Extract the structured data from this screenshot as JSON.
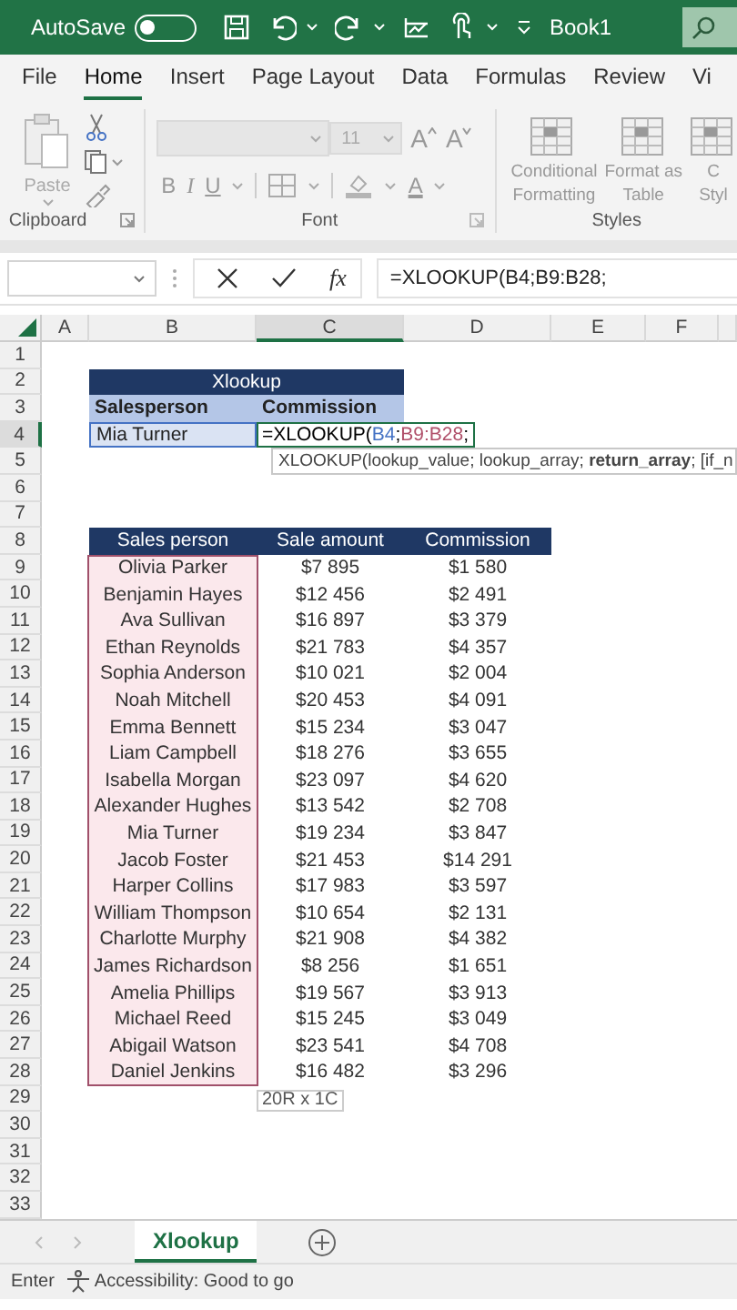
{
  "title_bar": {
    "autosave_label": "AutoSave",
    "autosave_on": false,
    "title": "Book1"
  },
  "tabs": [
    {
      "label": "File",
      "selected": false
    },
    {
      "label": "Home",
      "selected": true
    },
    {
      "label": "Insert",
      "selected": false
    },
    {
      "label": "Page Layout",
      "selected": false
    },
    {
      "label": "Data",
      "selected": false
    },
    {
      "label": "Formulas",
      "selected": false
    },
    {
      "label": "Review",
      "selected": false
    },
    {
      "label": "Vi",
      "selected": false
    }
  ],
  "ribbon": {
    "clipboard": {
      "paste": "Paste",
      "label": "Clipboard"
    },
    "font": {
      "size": "11",
      "grow": "A",
      "shrink": "A",
      "bold": "B",
      "italic": "I",
      "underline": "U",
      "font_color": "A",
      "label": "Font"
    },
    "styles": {
      "buttons": [
        {
          "line1": "Conditional",
          "line2": "Formatting"
        },
        {
          "line1": "Format as",
          "line2": "Table"
        },
        {
          "line1": "C",
          "line2": "Styl"
        }
      ],
      "label": "Styles"
    }
  },
  "formula_bar": {
    "fx": "fx",
    "formula": "=XLOOKUP(B4;B9:B28;"
  },
  "columns": [
    {
      "label": "A",
      "selected": false
    },
    {
      "label": "B",
      "selected": false
    },
    {
      "label": "C",
      "selected": true
    },
    {
      "label": "D",
      "selected": false
    },
    {
      "label": "E",
      "selected": false
    },
    {
      "label": "F",
      "selected": false
    }
  ],
  "rows": [
    {
      "label": "1",
      "selected": false
    },
    {
      "label": "2",
      "selected": false
    },
    {
      "label": "3",
      "selected": false
    },
    {
      "label": "4",
      "selected": true
    },
    {
      "label": "5",
      "selected": false
    },
    {
      "label": "6",
      "selected": false
    },
    {
      "label": "7",
      "selected": false
    },
    {
      "label": "8",
      "selected": false
    },
    {
      "label": "9",
      "selected": false
    },
    {
      "label": "10",
      "selected": false
    },
    {
      "label": "11",
      "selected": false
    },
    {
      "label": "12",
      "selected": false
    },
    {
      "label": "13",
      "selected": false
    },
    {
      "label": "14",
      "selected": false
    },
    {
      "label": "15",
      "selected": false
    },
    {
      "label": "16",
      "selected": false
    },
    {
      "label": "17",
      "selected": false
    },
    {
      "label": "18",
      "selected": false
    },
    {
      "label": "19",
      "selected": false
    },
    {
      "label": "20",
      "selected": false
    },
    {
      "label": "21",
      "selected": false
    },
    {
      "label": "22",
      "selected": false
    },
    {
      "label": "23",
      "selected": false
    },
    {
      "label": "24",
      "selected": false
    },
    {
      "label": "25",
      "selected": false
    },
    {
      "label": "26",
      "selected": false
    },
    {
      "label": "27",
      "selected": false
    },
    {
      "label": "28",
      "selected": false
    },
    {
      "label": "29",
      "selected": false
    },
    {
      "label": "30",
      "selected": false
    },
    {
      "label": "31",
      "selected": false
    },
    {
      "label": "32",
      "selected": false
    },
    {
      "label": "33",
      "selected": false
    }
  ],
  "lookup_table": {
    "title": "Xlookup",
    "headers": [
      "Salesperson",
      "Commission"
    ],
    "value": "Mia Turner",
    "formula_parts": [
      {
        "text": "=XLOOKUP(",
        "color": "#000000"
      },
      {
        "text": "B4",
        "color": "#4472c4"
      },
      {
        "text": ";",
        "color": "#000000"
      },
      {
        "text": "B9:B28",
        "color": "#b0506a"
      },
      {
        "text": ";",
        "color": "#000000"
      }
    ]
  },
  "tooltip": "XLOOKUP(lookup_value; lookup_array; **return_array**; [if_n",
  "sales_table": {
    "headers": [
      "Sales person",
      "Sale amount",
      "Commission"
    ],
    "name_range_highlighted": true,
    "rows": [
      {
        "name": "Olivia Parker",
        "sale": "$7 895",
        "commission": "$1 580"
      },
      {
        "name": "Benjamin Hayes",
        "sale": "$12 456",
        "commission": "$2 491"
      },
      {
        "name": "Ava Sullivan",
        "sale": "$16 897",
        "commission": "$3 379"
      },
      {
        "name": "Ethan Reynolds",
        "sale": "$21 783",
        "commission": "$4 357"
      },
      {
        "name": "Sophia Anderson",
        "sale": "$10 021",
        "commission": "$2 004"
      },
      {
        "name": "Noah Mitchell",
        "sale": "$20 453",
        "commission": "$4 091"
      },
      {
        "name": "Emma Bennett",
        "sale": "$15 234",
        "commission": "$3 047"
      },
      {
        "name": "Liam Campbell",
        "sale": "$18 276",
        "commission": "$3 655"
      },
      {
        "name": "Isabella Morgan",
        "sale": "$23 097",
        "commission": "$4 620"
      },
      {
        "name": "Alexander Hughes",
        "sale": "$13 542",
        "commission": "$2 708"
      },
      {
        "name": "Mia Turner",
        "sale": "$19 234",
        "commission": "$3 847"
      },
      {
        "name": "Jacob Foster",
        "sale": "$21 453",
        "commission": "$14 291"
      },
      {
        "name": "Harper Collins",
        "sale": "$17 983",
        "commission": "$3 597"
      },
      {
        "name": "William Thompson",
        "sale": "$10 654",
        "commission": "$2 131"
      },
      {
        "name": "Charlotte Murphy",
        "sale": "$21 908",
        "commission": "$4 382"
      },
      {
        "name": "James Richardson",
        "sale": "$8 256",
        "commission": "$1 651"
      },
      {
        "name": "Amelia Phillips",
        "sale": "$19 567",
        "commission": "$3 913"
      },
      {
        "name": "Michael Reed",
        "sale": "$15 245",
        "commission": "$3 049"
      },
      {
        "name": "Abigail Watson",
        "sale": "$23 541",
        "commission": "$4 708"
      },
      {
        "name": "Daniel Jenkins",
        "sale": "$16 482",
        "commission": "$3 296"
      }
    ]
  },
  "selection_size": "20R x 1C",
  "sheet_tabs": [
    {
      "label": "Xlookup",
      "selected": true
    }
  ],
  "status_bar": {
    "mode": "Enter",
    "accessibility": "Accessibility: Good to go"
  }
}
